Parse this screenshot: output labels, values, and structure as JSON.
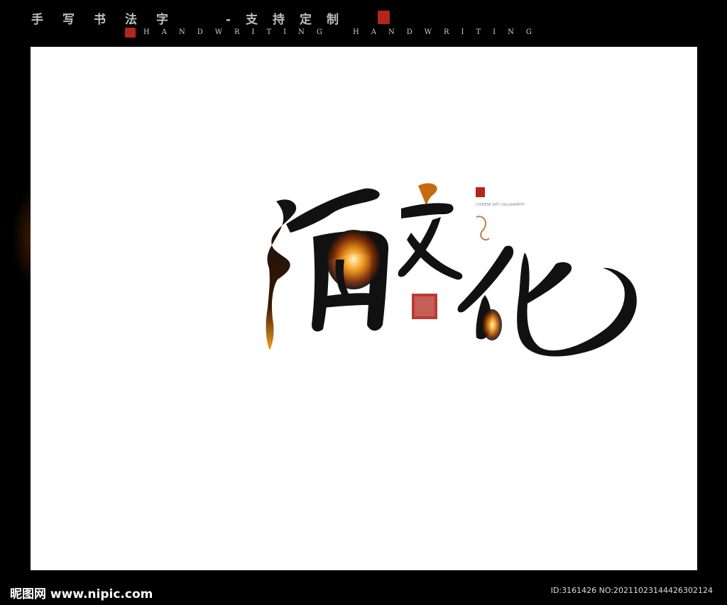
{
  "header": {
    "title": "手写书法字",
    "suffix": "-支持定制",
    "handwriting_1": "HANDWRITING",
    "handwriting_2": "HANDWRITING"
  },
  "artwork": {
    "calligraphy_text": "酒文化",
    "seal_small_text": "CHINESE ART CALLIGRAPHY",
    "glow_color": "#f59a1a",
    "seal_color": "#b3261e"
  },
  "footer": {
    "logo": "昵图网 www.nipic.com",
    "id_text": "ID:3161426 NO:20211023144426302124"
  }
}
